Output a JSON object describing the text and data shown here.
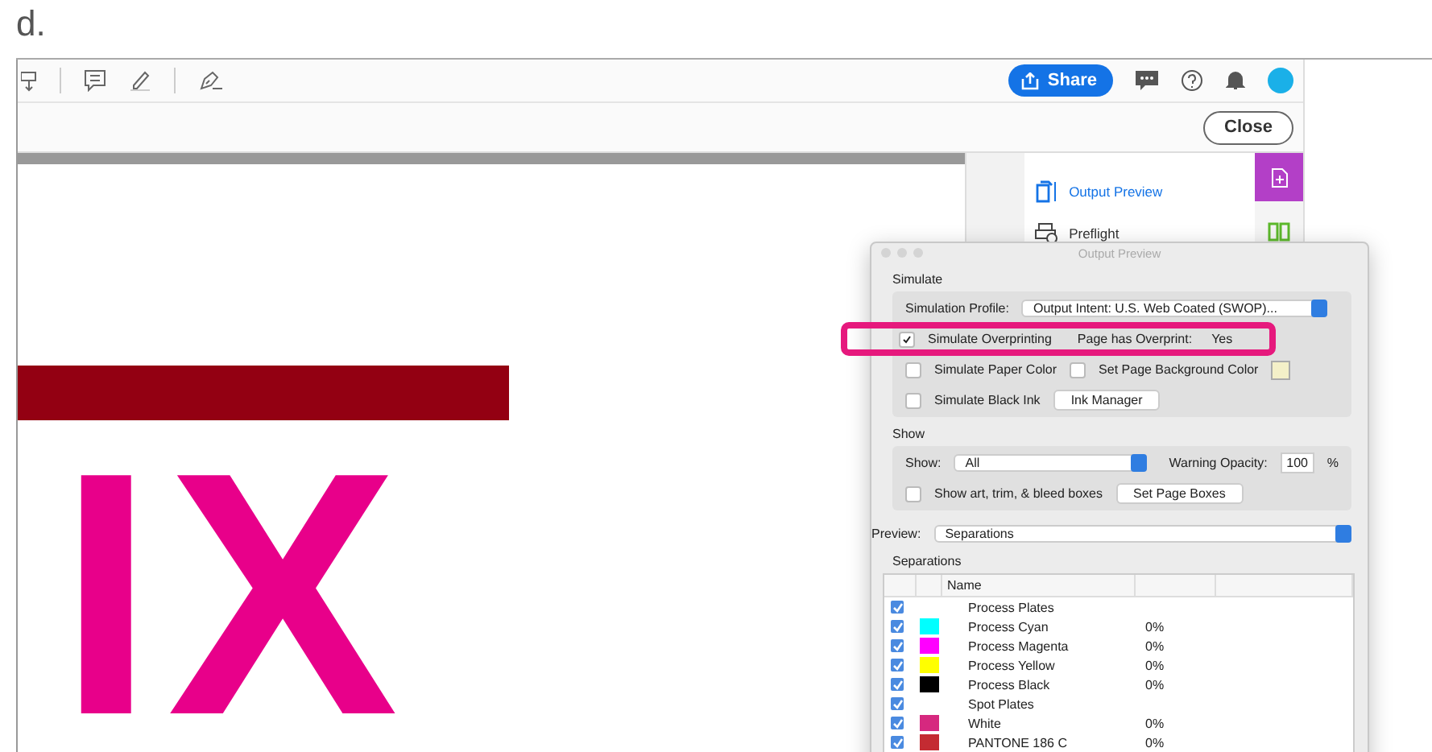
{
  "label": "d.",
  "toolbar": {
    "share_button": "Share"
  },
  "close_button": "Close",
  "document": {
    "art_text": "IX"
  },
  "tools_panel": [
    {
      "label": "Output Preview",
      "selected": true
    },
    {
      "label": "Preflight",
      "selected": false
    }
  ],
  "dialog": {
    "title": "Output Preview",
    "simulate": {
      "heading": "Simulate",
      "profile_label": "Simulation Profile:",
      "profile_value": "Output Intent: U.S. Web Coated (SWOP)...",
      "overprinting": {
        "label": "Simulate Overprinting",
        "checked": true
      },
      "overprint_label": "Page has Overprint:",
      "overprint_value": "Yes",
      "paper_color": {
        "label": "Simulate Paper Color",
        "checked": false
      },
      "background_color": {
        "label": "Set Page Background Color",
        "checked": false
      },
      "black_ink": {
        "label": "Simulate Black Ink",
        "checked": false
      },
      "ink_manager_button": "Ink Manager"
    },
    "show": {
      "heading": "Show",
      "show_label": "Show:",
      "show_value": "All",
      "opacity_label": "Warning Opacity:",
      "opacity_value": "100",
      "percent": "%",
      "boxes": {
        "label": "Show art, trim, & bleed boxes",
        "checked": false
      },
      "page_boxes_button": "Set Page Boxes"
    },
    "preview_label": "Preview:",
    "preview_value": "Separations",
    "separations": {
      "heading": "Separations",
      "column_name": "Name",
      "rows": [
        {
          "kind": "group",
          "name": "Process Plates",
          "checked": true
        },
        {
          "kind": "plate",
          "name": "Process Cyan",
          "checked": true,
          "color": "#00ffff",
          "coverage": "0%"
        },
        {
          "kind": "plate",
          "name": "Process Magenta",
          "checked": true,
          "color": "#ff00ff",
          "coverage": "0%"
        },
        {
          "kind": "plate",
          "name": "Process Yellow",
          "checked": true,
          "color": "#ffff00",
          "coverage": "0%"
        },
        {
          "kind": "plate",
          "name": "Process Black",
          "checked": true,
          "color": "#000000",
          "coverage": "0%"
        },
        {
          "kind": "group",
          "name": "Spot Plates",
          "checked": true
        },
        {
          "kind": "plate",
          "name": "White",
          "checked": true,
          "color": "#d6287f",
          "coverage": "0%"
        },
        {
          "kind": "plate",
          "name": "PANTONE 186 C",
          "checked": true,
          "color": "#c42b32",
          "coverage": "0%"
        }
      ]
    }
  }
}
